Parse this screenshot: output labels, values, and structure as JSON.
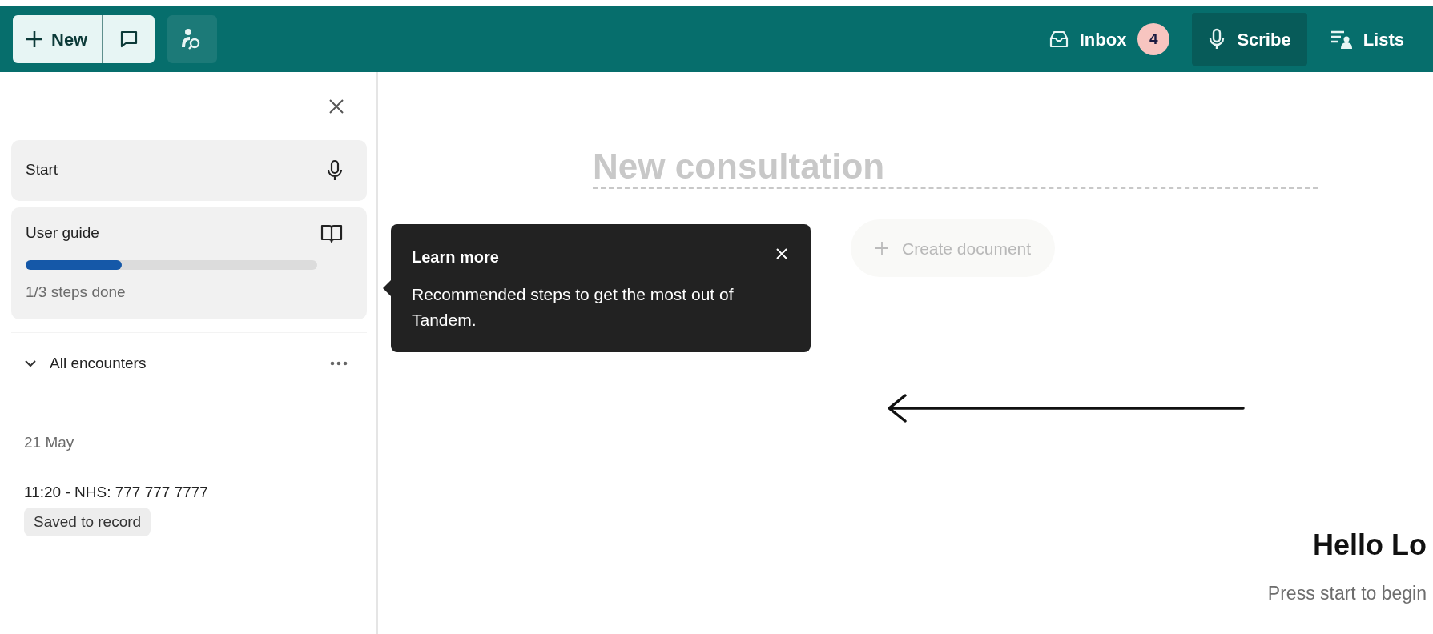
{
  "toolbar": {
    "new_label": "New"
  },
  "nav": [
    {
      "kind": "inbox",
      "label": "Inbox",
      "badge": "4",
      "selected": false
    },
    {
      "kind": "mic",
      "label": "Scribe",
      "selected": true
    },
    {
      "kind": "lists",
      "label": "Lists",
      "selected": false
    }
  ],
  "sidebar": {
    "items": [
      {
        "kind": "start",
        "label": "Start"
      },
      {
        "kind": "guide",
        "label": "User guide",
        "level": 0.33,
        "caption": "1/3 steps done"
      }
    ],
    "section": {
      "label": "All encounters",
      "expanded": true
    },
    "date": "21 May",
    "encounters": [
      {
        "title": "11:20 - NHS: 777 777 7777",
        "status": "Saved to record"
      }
    ]
  },
  "main": {
    "title_placeholder": "New consultation",
    "create_label": "Create document",
    "greeting": "Hello Lo",
    "hint": "Press start to begin"
  },
  "tooltip": {
    "title": "Learn more",
    "body": "Recommended steps to get the most out of Tandem."
  }
}
